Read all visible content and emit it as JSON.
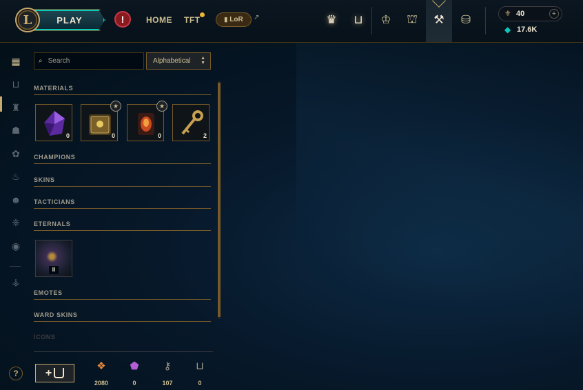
{
  "topbar": {
    "logo_letter": "L",
    "play_label": "PLAY",
    "alert_glyph": "!",
    "nav": [
      {
        "label": "HOME"
      },
      {
        "label": "TFT"
      }
    ],
    "lor_label": "LoR",
    "lor_arrow": "↗",
    "icons": [
      {
        "name": "ranked-icon",
        "glyph": "♛"
      },
      {
        "name": "collection-icon",
        "glyph": "⊔"
      },
      {
        "name": "missions-icon",
        "glyph": "♔"
      },
      {
        "name": "loot-chest-icon",
        "glyph": "⛫"
      },
      {
        "name": "loot-tools-icon",
        "glyph": "⚒"
      },
      {
        "name": "store-icon",
        "glyph": "⛁"
      }
    ],
    "wallet": {
      "rp_icon": "⚜",
      "rp_value": "40",
      "add_glyph": "+",
      "be_icon": "◆",
      "be_value": "17.6K"
    }
  },
  "rail": {
    "items": [
      {
        "name": "rail-all-loot-icon",
        "glyph": "▦"
      },
      {
        "name": "rail-chests-icon",
        "glyph": "⊔"
      },
      {
        "name": "rail-champions-icon",
        "glyph": "♜"
      },
      {
        "name": "rail-skins-icon",
        "glyph": "☗"
      },
      {
        "name": "rail-tacticians-icon",
        "glyph": "✿"
      },
      {
        "name": "rail-eternals-icon",
        "glyph": "♨"
      },
      {
        "name": "rail-emotes-icon",
        "glyph": "☻"
      },
      {
        "name": "rail-ward-skins-icon",
        "glyph": "❈"
      },
      {
        "name": "rail-icons-icon",
        "glyph": "◉"
      },
      {
        "name": "rail-disenchant-icon",
        "glyph": "⚶"
      }
    ],
    "help_glyph": "?"
  },
  "loot": {
    "search_placeholder": "Search",
    "search_glyph": "🔍",
    "sort_value": "Alphabetical",
    "sections": {
      "materials": "MATERIALS",
      "champions": "CHAMPIONS",
      "skins": "SKINS",
      "tacticians": "TACTICIANS",
      "eternals": "ETERNALS",
      "emotes": "EMOTES",
      "ward_skins": "WARD SKINS",
      "icons": "ICONS"
    },
    "materials": [
      {
        "name": "gemstone-tile",
        "count": "0"
      },
      {
        "name": "masterwork-chest-tile",
        "count": "0",
        "star": "★"
      },
      {
        "name": "orb-tile",
        "count": "0",
        "star": "★"
      },
      {
        "name": "key-tile",
        "count": "2"
      }
    ],
    "eternal": {
      "roman": "II"
    }
  },
  "bottom": {
    "craft_plus": "+",
    "currencies": [
      {
        "name": "orange-essence",
        "glyph": "❖",
        "color": "#e8893a",
        "value": "2080"
      },
      {
        "name": "mythic-essence",
        "glyph": "⬟",
        "color": "#b45ed6",
        "value": "0"
      },
      {
        "name": "key-fragment",
        "glyph": "⚷",
        "color": "#a09b8c",
        "value": "107"
      },
      {
        "name": "chest",
        "glyph": "⊔",
        "color": "#a09b8c",
        "value": "0"
      }
    ]
  }
}
